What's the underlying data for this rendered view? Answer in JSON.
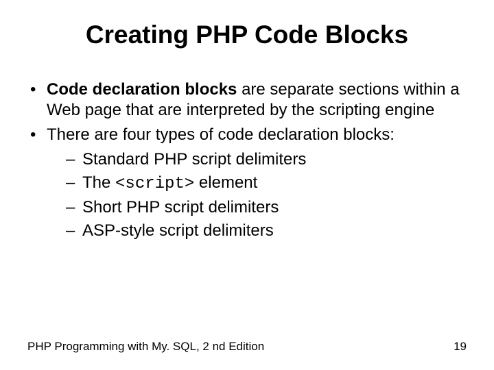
{
  "title": "Creating PHP Code Blocks",
  "bullets": [
    {
      "bold_lead": "Code declaration blocks",
      "rest": " are separate sections within a Web page that are interpreted by the scripting engine"
    },
    {
      "text": "There are four types of code declaration blocks:",
      "sub": [
        "Standard PHP script delimiters",
        {
          "pre": "The ",
          "code": "<script>",
          "post": " element"
        },
        "Short PHP script delimiters",
        "ASP-style script delimiters"
      ]
    }
  ],
  "footer": {
    "left": "PHP Programming with My. SQL, 2 nd Edition",
    "right": "19"
  }
}
